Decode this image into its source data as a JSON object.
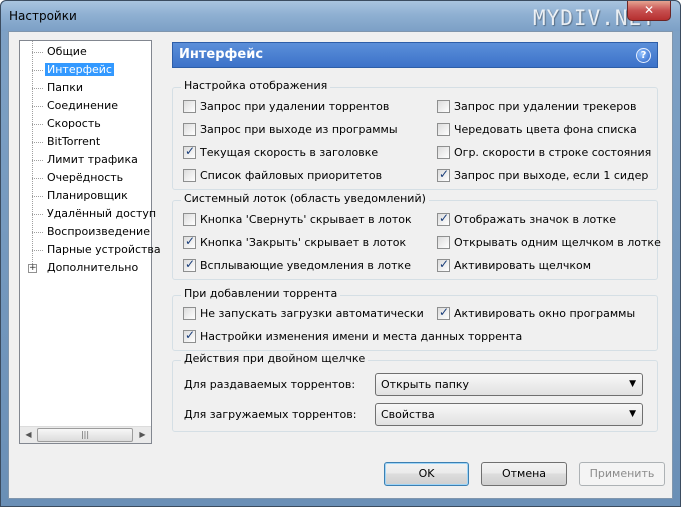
{
  "window": {
    "title": "Настройки",
    "watermark": "MYDIV.NET",
    "close_label": "✕"
  },
  "tree": {
    "items": [
      {
        "label": "Общие",
        "selected": false
      },
      {
        "label": "Интерфейс",
        "selected": true
      },
      {
        "label": "Папки",
        "selected": false
      },
      {
        "label": "Соединение",
        "selected": false
      },
      {
        "label": "Скорость",
        "selected": false
      },
      {
        "label": "BitTorrent",
        "selected": false
      },
      {
        "label": "Лимит трафика",
        "selected": false
      },
      {
        "label": "Очерёдность",
        "selected": false
      },
      {
        "label": "Планировщик",
        "selected": false
      },
      {
        "label": "Удалённый доступ",
        "selected": false
      },
      {
        "label": "Воспроизведение",
        "selected": false
      },
      {
        "label": "Парные устройства",
        "selected": false
      },
      {
        "label": "Дополнительно",
        "selected": false,
        "expandable": true
      }
    ],
    "expander_label": "+",
    "scroll_left": "◀",
    "scroll_right": "▶",
    "scroll_grip": "|||"
  },
  "header": {
    "title": "Интерфейс",
    "help_label": "?"
  },
  "display": {
    "title": "Настройка отображения",
    "items": [
      {
        "label": "Запрос при удалении торрентов",
        "checked": false
      },
      {
        "label": "Запрос при удалении трекеров",
        "checked": false
      },
      {
        "label": "Запрос при выходе из программы",
        "checked": false
      },
      {
        "label": "Чередовать цвета фона списка",
        "checked": false
      },
      {
        "label": "Текущая скорость в заголовке",
        "checked": true
      },
      {
        "label": "Огр. скорости в строке состояния",
        "checked": false
      },
      {
        "label": "Список файловых приоритетов",
        "checked": false
      },
      {
        "label": "Запрос при выходе, если 1 сидер",
        "checked": true
      }
    ]
  },
  "tray": {
    "title": "Системный лоток (область уведомлений)",
    "items": [
      {
        "label": "Кнопка 'Свернуть' скрывает в лоток",
        "checked": false
      },
      {
        "label": "Отображать значок в лотке",
        "checked": true
      },
      {
        "label": "Кнопка 'Закрыть' скрывает в лоток",
        "checked": true
      },
      {
        "label": "Открывать одним щелчком в лотке",
        "checked": false
      },
      {
        "label": "Всплывающие уведомления в лотке",
        "checked": true
      },
      {
        "label": "Активировать щелчком",
        "checked": true
      }
    ]
  },
  "adding": {
    "title": "При добавлении торрента",
    "items": [
      {
        "label": "Не запускать загрузки автоматически",
        "checked": false
      },
      {
        "label": "Активировать окно программы",
        "checked": true
      },
      {
        "label": "Настройки изменения имени и места данных торрента",
        "checked": true
      }
    ]
  },
  "doubleclick": {
    "title": "Действия при двойном щелчке",
    "seeding_label": "Для раздаваемых торрентов:",
    "seeding_value": "Открыть папку",
    "downloading_label": "Для загружаемых торрентов:",
    "downloading_value": "Свойства",
    "caret": "▼"
  },
  "buttons": {
    "ok": "OK",
    "cancel": "Отмена",
    "apply": "Применить"
  }
}
